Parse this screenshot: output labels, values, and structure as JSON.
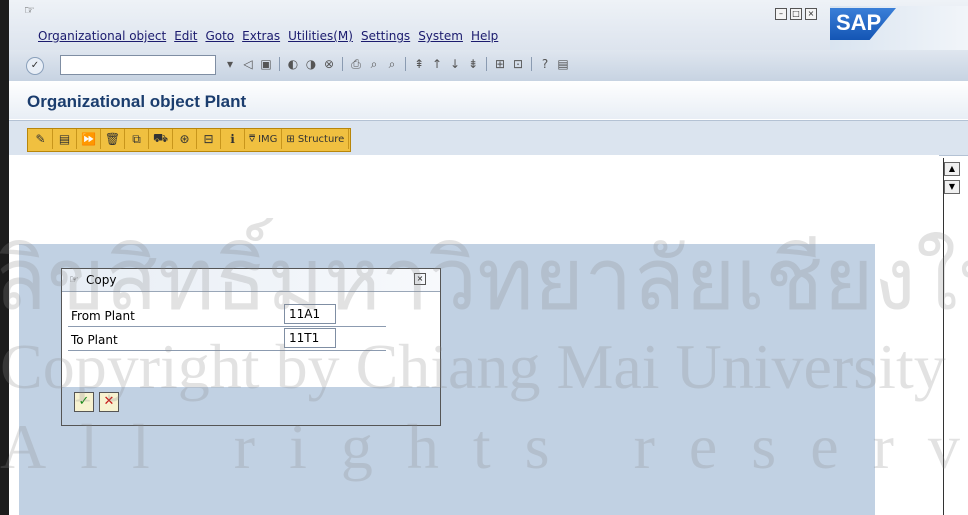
{
  "menubar": {
    "items": [
      "Organizational object",
      "Edit",
      "Goto",
      "Extras",
      "Utilities(M)",
      "Settings",
      "System",
      "Help"
    ],
    "logo": "SAP"
  },
  "toolbar": {
    "command_value": "",
    "icons": [
      "enter-icon",
      "save-icon",
      "back-icon",
      "exit-icon",
      "cancel-icon",
      "print-icon",
      "find-icon",
      "find-next-icon",
      "first-page-icon",
      "prev-page-icon",
      "next-page-icon",
      "last-page-icon",
      "create-session-icon",
      "shortcut-icon",
      "help-icon",
      "layout-icon"
    ]
  },
  "title": "Organizational object Plant",
  "app_toolbar": {
    "img_label": "IMG",
    "structure_label": "Structure"
  },
  "dialog": {
    "title": "Copy",
    "rows": [
      {
        "label": "From Plant",
        "value": "11A1"
      },
      {
        "label": "To Plant",
        "value": "11T1"
      }
    ]
  },
  "watermark": {
    "line1": "ลิขสิทธิ์มหาวิทยาลัยเชียงใหม่",
    "line2": "Copyright by Chiang Mai University",
    "line3": "All rights reserved"
  }
}
